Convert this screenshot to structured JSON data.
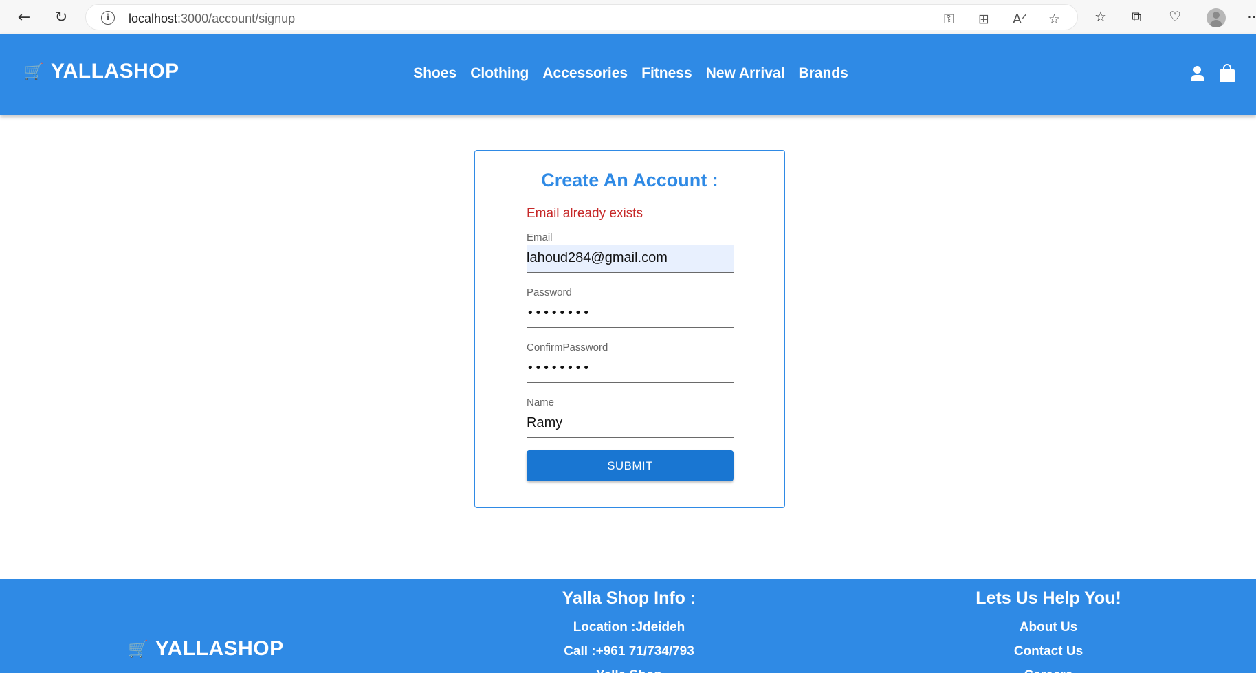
{
  "browser": {
    "url_host": "localhost",
    "url_path": ":3000/account/signup",
    "info_glyph": "i"
  },
  "header": {
    "logo_text": "YALLASHOP",
    "nav": [
      "Shoes",
      "Clothing",
      "Accessories",
      "Fitness",
      "New Arrival",
      "Brands"
    ]
  },
  "signup": {
    "title": "Create An Account :",
    "error": "Email already exists",
    "email_label": "Email",
    "email_value": "lahoud284@gmail.com",
    "password_label": "Password",
    "password_value": "••••••••",
    "confirm_label": "ConfirmPassword",
    "confirm_value": "••••••••",
    "name_label": "Name",
    "name_value": "Ramy",
    "submit_label": "SUBMIT"
  },
  "footer": {
    "logo_text": "YALLASHOP",
    "info_title": "Yalla Shop Info :",
    "info_lines": [
      "Location :Jdeideh",
      "Call :+961 71/734/793",
      "Yalla Shop"
    ],
    "help_title": "Lets Us Help You!",
    "help_links": [
      "About Us",
      "Contact Us",
      "Careers"
    ]
  },
  "colors": {
    "brand_blue": "#2f8ae5",
    "button_blue": "#1976d2",
    "error_red": "#c62828"
  }
}
